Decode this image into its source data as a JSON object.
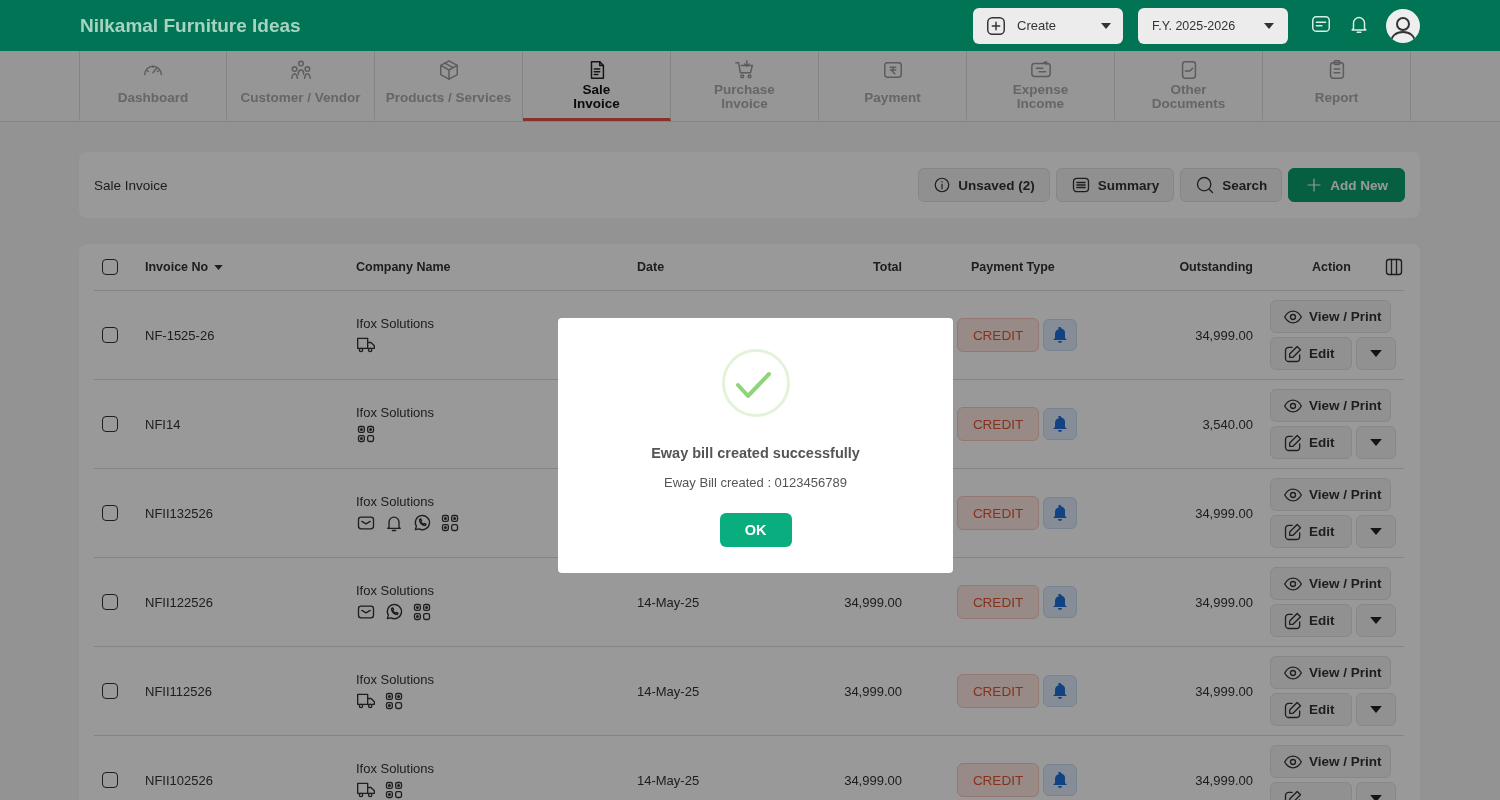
{
  "header": {
    "title": "Nilkamal Furniture Ideas",
    "create_button": "Create",
    "fy_select": "F.Y. 2025-2026"
  },
  "nav_tabs": [
    {
      "label": "Dashboard",
      "selected": false
    },
    {
      "label": "Customer / Vendor",
      "selected": false
    },
    {
      "label": "Products / Services",
      "selected": false
    },
    {
      "label": "Sale\nInvoice",
      "selected": true
    },
    {
      "label": "Purchase\nInvoice",
      "selected": false
    },
    {
      "label": "Payment",
      "selected": false
    },
    {
      "label": "Expense\nIncome",
      "selected": false
    },
    {
      "label": "Other\nDocuments",
      "selected": false
    },
    {
      "label": "Report",
      "selected": false
    }
  ],
  "toolbar": {
    "title": "Sale Invoice",
    "buttons": [
      {
        "label": "Unsaved (2)",
        "kind": "info"
      },
      {
        "label": "Summary",
        "kind": "list"
      },
      {
        "label": "Search",
        "kind": "search"
      },
      {
        "label": "Add New",
        "kind": "add"
      }
    ]
  },
  "table": {
    "select_all_checked": false,
    "columns": [
      "Invoice No",
      "Company Name",
      "Date",
      "Total",
      "Payment Type",
      "Outstanding",
      "Action"
    ],
    "rows": [
      {
        "checked": false,
        "invoice_no": "NF-1525-26",
        "company": "Ifox Solutions",
        "icons": [
          {
            "kind": "truck"
          }
        ],
        "payment_type": "CREDIT",
        "outstanding": "34,999.00",
        "view": "View / Print",
        "edit": "Edit"
      },
      {
        "checked": false,
        "invoice_no": "NFI14",
        "company": "Ifox Solutions",
        "icons": [
          {
            "kind": "qr"
          }
        ],
        "payment_type": "CREDIT",
        "outstanding": "3,540.00",
        "view": "View / Print",
        "edit": "Edit"
      },
      {
        "checked": false,
        "invoice_no": "NFII132526",
        "company": "Ifox Solutions",
        "icons": [
          {
            "kind": "mail"
          },
          {
            "kind": "bell"
          },
          {
            "kind": "whatsapp"
          },
          {
            "kind": "qr"
          }
        ],
        "payment_type": "CREDIT",
        "outstanding": "34,999.00",
        "view": "View / Print",
        "edit": "Edit"
      },
      {
        "checked": false,
        "invoice_no": "NFII122526",
        "company": "Ifox Solutions",
        "icons": [
          {
            "kind": "mail"
          },
          {
            "kind": "whatsapp"
          },
          {
            "kind": "qr"
          }
        ],
        "date": "14-May-25",
        "total": "34,999.00",
        "payment_type": "CREDIT",
        "outstanding": "34,999.00",
        "view": "View / Print",
        "edit": "Edit"
      },
      {
        "checked": false,
        "invoice_no": "NFII112526",
        "company": "Ifox Solutions",
        "icons": [
          {
            "kind": "truck"
          },
          {
            "kind": "qr"
          }
        ],
        "date": "14-May-25",
        "total": "34,999.00",
        "payment_type": "CREDIT",
        "outstanding": "34,999.00",
        "view": "View / Print",
        "edit": "Edit"
      },
      {
        "checked": false,
        "invoice_no": "NFII102526",
        "company": "Ifox Solutions",
        "icons": [
          {
            "kind": "truck"
          },
          {
            "kind": "qr"
          }
        ],
        "date": "14-May-25",
        "total": "34,999.00",
        "payment_type": "CREDIT",
        "outstanding": "34,999.00",
        "view": "View / Print"
      }
    ]
  },
  "dialog": {
    "title": "Eway bill created successfully",
    "message": "Eway Bill created : 0123456789",
    "ok_button": "OK"
  }
}
